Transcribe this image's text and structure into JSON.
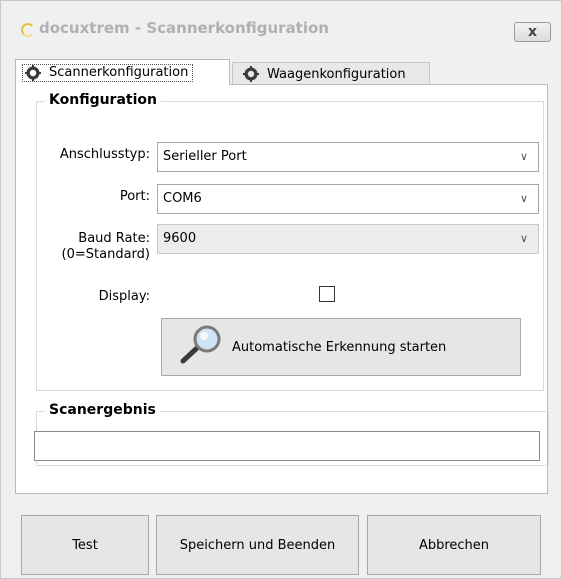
{
  "window": {
    "title": "docuxtrem - Scannerkonfiguration",
    "close_label": "x"
  },
  "tabs": [
    {
      "label": "Scannerkonfiguration",
      "icon": "gear-icon",
      "active": true
    },
    {
      "label": "Waagenkonfiguration",
      "icon": "gear-icon",
      "active": false
    }
  ],
  "konfiguration": {
    "legend": "Konfiguration",
    "anschlusstyp": {
      "label": "Anschlusstyp:",
      "value": "Serieller Port"
    },
    "port": {
      "label": "Port:",
      "value": "COM6"
    },
    "baudrate": {
      "label_line1": "Baud Rate:",
      "label_line2": "(0=Standard)",
      "value": "9600"
    },
    "display": {
      "label": "Display:",
      "checked": false
    },
    "autodetect_label": "Automatische Erkennung starten"
  },
  "scanergebnis": {
    "legend": "Scanergebnis",
    "value": ""
  },
  "buttons": {
    "test": "Test",
    "save_exit": "Speichern und Beenden",
    "cancel": "Abbrechen"
  },
  "colors": {
    "window_bg": "#f0f0f0",
    "panel_bg": "#ffffff",
    "button_bg": "#e6e6e6",
    "title_text": "#b0b0b0"
  }
}
